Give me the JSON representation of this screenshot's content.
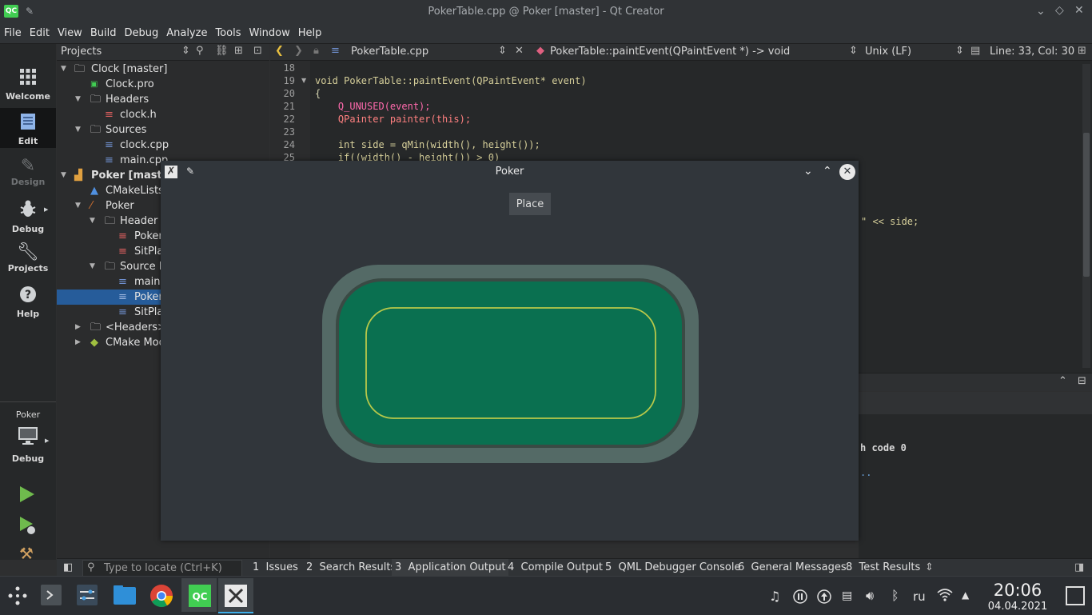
{
  "window": {
    "title": "PokerTable.cpp @ Poker [master] - Qt Creator",
    "logo": "QC"
  },
  "menu": [
    "File",
    "Edit",
    "View",
    "Build",
    "Debug",
    "Analyze",
    "Tools",
    "Window",
    "Help"
  ],
  "modes": [
    {
      "label": "Welcome",
      "icon": "grid-icon"
    },
    {
      "label": "Edit",
      "icon": "document-icon"
    },
    {
      "label": "Design",
      "icon": "pencil-icon"
    },
    {
      "label": "Debug",
      "icon": "bug-icon"
    },
    {
      "label": "Projects",
      "icon": "wrench-icon"
    },
    {
      "label": "Help",
      "icon": "question-icon"
    }
  ],
  "kit": {
    "project": "Poker",
    "mode": "Debug"
  },
  "projects": {
    "header": "Projects",
    "tree": [
      {
        "label": "Clock [master]",
        "bold": false
      },
      {
        "label": "Clock.pro"
      },
      {
        "label": "Headers"
      },
      {
        "label": "clock.h"
      },
      {
        "label": "Sources"
      },
      {
        "label": "clock.cpp"
      },
      {
        "label": "main.cpp"
      },
      {
        "label": "Poker [master]",
        "bold": true
      },
      {
        "label": "CMakeLists.t"
      },
      {
        "label": "Poker"
      },
      {
        "label": "Header Fi"
      },
      {
        "label": "Poker"
      },
      {
        "label": "SitPlac"
      },
      {
        "label": "Source Fi"
      },
      {
        "label": "main.c"
      },
      {
        "label": "Poker"
      },
      {
        "label": "SitPlac"
      },
      {
        "label": "<Headers>"
      },
      {
        "label": "CMake Modu"
      }
    ]
  },
  "editor": {
    "file": "PokerTable.cpp",
    "symbol": "PokerTable::paintEvent(QPaintEvent *) -> void",
    "line_ending": "Unix (LF)",
    "position": "Line: 33, Col: 30",
    "lines": [
      {
        "n": "18",
        "text": ""
      },
      {
        "n": "19",
        "text": "void PokerTable::paintEvent(QPaintEvent* event)"
      },
      {
        "n": "20",
        "text": "{"
      },
      {
        "n": "21",
        "text": "    Q_UNUSED(event);"
      },
      {
        "n": "22",
        "text": "    QPainter painter(this);"
      },
      {
        "n": "23",
        "text": ""
      },
      {
        "n": "24",
        "text": "    int side = qMin(width(), height());"
      },
      {
        "n": "25",
        "text": "    if((width() - height()) > 0)"
      }
    ],
    "partial_right": "\" << side;"
  },
  "output": {
    "exit_text": "h code 0",
    "dots": ".."
  },
  "statusbar": {
    "locate_placeholder": "Type to locate (Ctrl+K)",
    "tabs": [
      {
        "num": "1",
        "label": "Issues"
      },
      {
        "num": "2",
        "label": "Search Results"
      },
      {
        "num": "3",
        "label": "Application Output"
      },
      {
        "num": "4",
        "label": "Compile Output"
      },
      {
        "num": "5",
        "label": "QML Debugger Console"
      },
      {
        "num": "6",
        "label": "General Messages"
      },
      {
        "num": "8",
        "label": "Test Results"
      }
    ]
  },
  "poker_window": {
    "title": "Poker",
    "place_button": "Place"
  },
  "taskbar": {
    "time": "20:06",
    "date": "04.04.2021",
    "lang": "ru"
  },
  "colors": {
    "felt": "#0a7050",
    "rail": "#546a66",
    "accent_line": "#b8c84a",
    "selection": "#265c9a"
  }
}
